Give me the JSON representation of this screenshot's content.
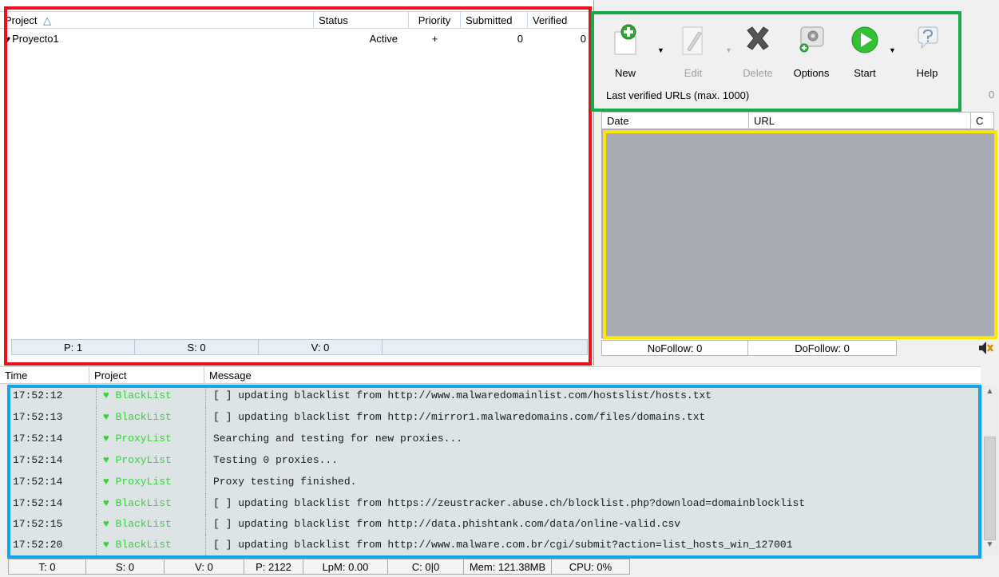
{
  "colors": {
    "red_box": "#e8111c",
    "green_box": "#1aa84c",
    "yellow_box": "#ffe600",
    "blue_box": "#12a6e6",
    "log_project": "#38d038",
    "url_area": "#a9acb5"
  },
  "projects": {
    "columns": {
      "project": "Project",
      "status": "Status",
      "priority": "Priority",
      "submitted": "Submitted",
      "verified": "Verified"
    },
    "rows": [
      {
        "icon": "heart-icon",
        "name": "Proyecto1",
        "status": "Active",
        "priority": "+",
        "submitted": "0",
        "verified": "0"
      }
    ],
    "footer": {
      "p": "P: 1",
      "s": "S: 0",
      "v": "V: 0"
    }
  },
  "toolbar": {
    "buttons": [
      {
        "label": "New",
        "icon": "new-icon",
        "enabled": true
      },
      {
        "label": "Edit",
        "icon": "edit-icon",
        "enabled": false
      },
      {
        "label": "Delete",
        "icon": "delete-icon",
        "enabled": false
      },
      {
        "label": "Options",
        "icon": "options-icon",
        "enabled": true
      },
      {
        "label": "Start",
        "icon": "start-icon",
        "enabled": true
      },
      {
        "label": "Help",
        "icon": "help-icon",
        "enabled": true
      }
    ],
    "last_verified_label": "Last verified URLs (max. 1000)",
    "last_verified_count": "0"
  },
  "urls": {
    "columns": {
      "date": "Date",
      "url": "URL",
      "c": "C"
    },
    "footer": {
      "nofollow": "NoFollow: 0",
      "dofollow": "DoFollow: 0"
    }
  },
  "log": {
    "columns": {
      "time": "Time",
      "project": "Project",
      "message": "Message"
    },
    "rows": [
      {
        "time": "17:52:12",
        "project": "♥ BlackList",
        "message": "[ ] updating blacklist from http://www.malwaredomainlist.com/hostslist/hosts.txt"
      },
      {
        "time": "17:52:13",
        "project": "♥ BlackList",
        "message": "[ ] updating blacklist from http://mirror1.malwaredomains.com/files/domains.txt"
      },
      {
        "time": "17:52:14",
        "project": "♥ ProxyList",
        "message": "Searching and testing for new proxies..."
      },
      {
        "time": "17:52:14",
        "project": "♥ ProxyList",
        "message": "Testing 0 proxies..."
      },
      {
        "time": "17:52:14",
        "project": "♥ ProxyList",
        "message": "Proxy testing finished."
      },
      {
        "time": "17:52:14",
        "project": "♥ BlackList",
        "message": "[ ] updating blacklist from https://zeustracker.abuse.ch/blocklist.php?download=domainblocklist"
      },
      {
        "time": "17:52:15",
        "project": "♥ BlackList",
        "message": "[ ] updating blacklist from http://data.phishtank.com/data/online-valid.csv"
      },
      {
        "time": "17:52:20",
        "project": "♥ BlackList",
        "message": "[ ] updating blacklist from http://www.malware.com.br/cgi/submit?action=list_hosts_win_127001"
      }
    ]
  },
  "status_bar": {
    "t": "T: 0",
    "s": "S: 0",
    "v": "V: 0",
    "p": "P: 2122",
    "lpm": "LpM: 0.00",
    "c": "C: 0|0",
    "mem": "Mem: 121.38MB",
    "cpu": "CPU: 0%"
  }
}
